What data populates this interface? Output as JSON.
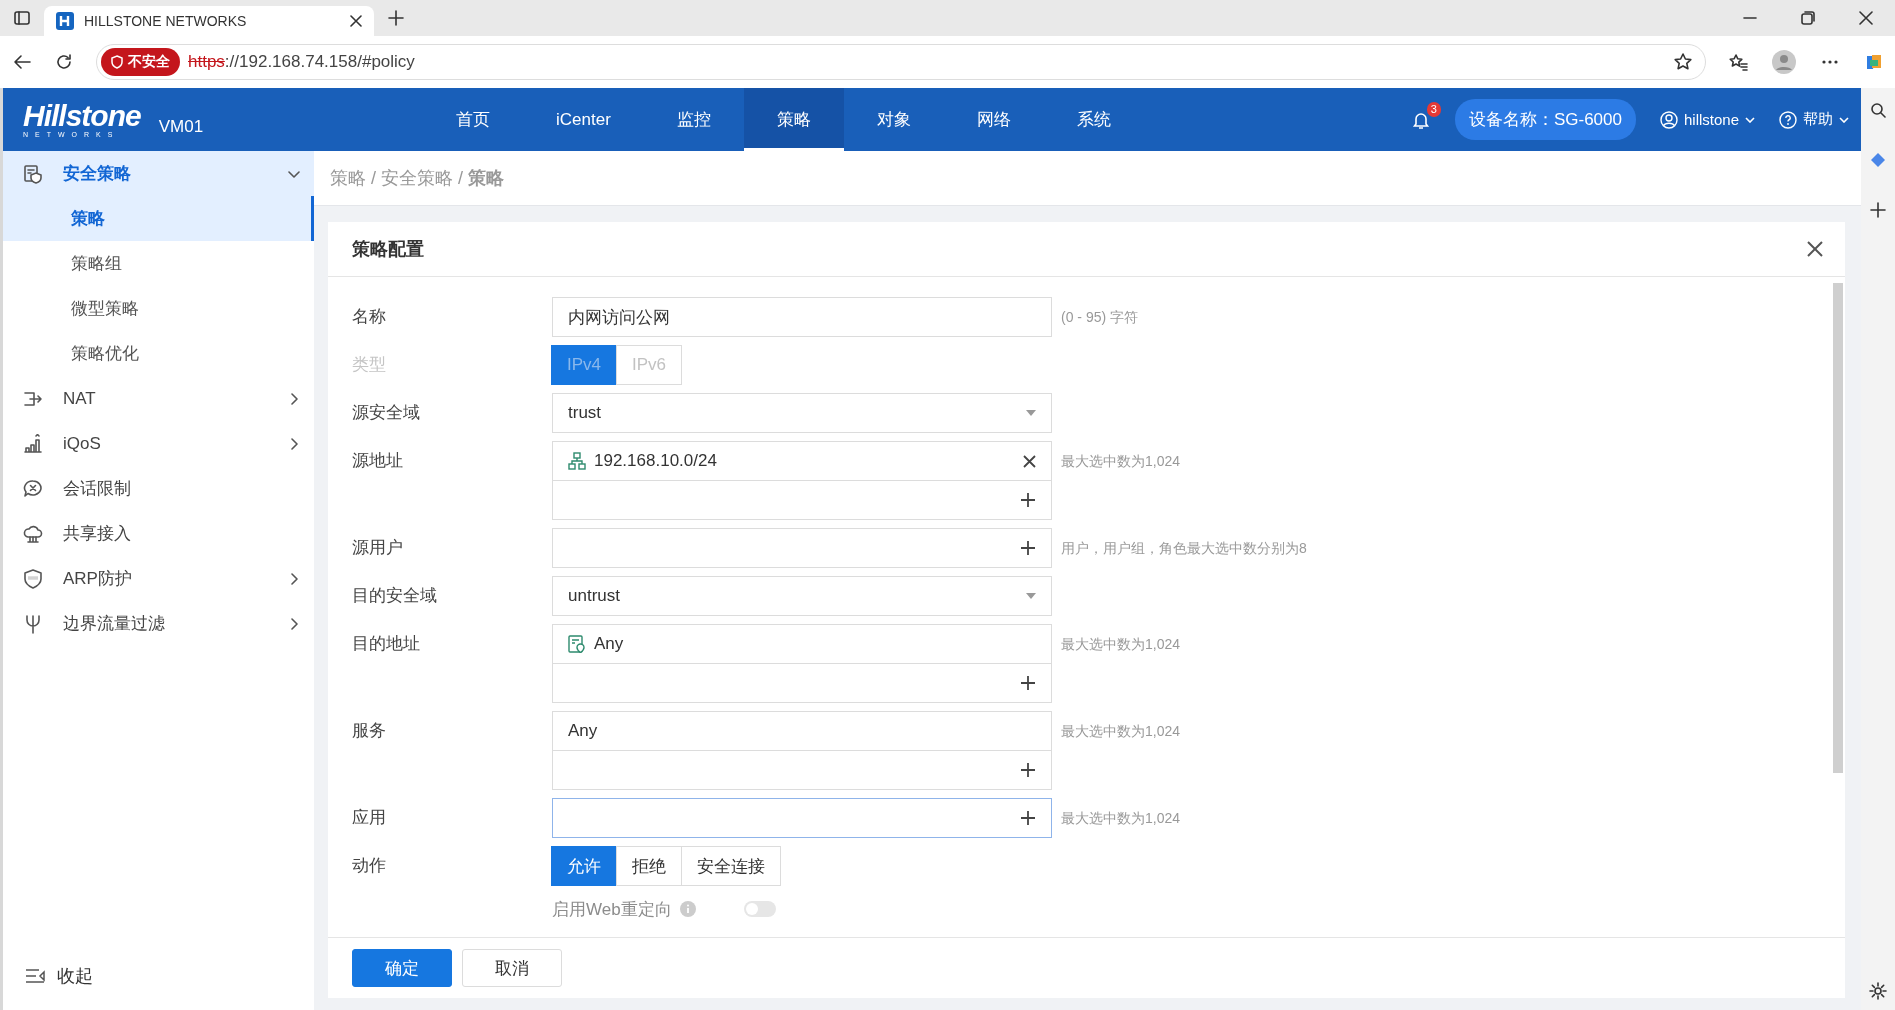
{
  "browser": {
    "tab_title": "HILLSTONE NETWORKS",
    "security_badge": "不安全",
    "url_scheme": "https",
    "url_rest": "://192.168.74.158/#policy"
  },
  "header": {
    "logo": "Hillstone",
    "logo_sub": "NETWORKS",
    "device": "VM01",
    "nav": [
      {
        "label": "首页",
        "selected": false
      },
      {
        "label": "iCenter",
        "selected": false
      },
      {
        "label": "监控",
        "selected": false
      },
      {
        "label": "策略",
        "selected": true
      },
      {
        "label": "对象",
        "selected": false
      },
      {
        "label": "网络",
        "selected": false
      },
      {
        "label": "系统",
        "selected": false
      }
    ],
    "notifications": "3",
    "device_name": "设备名称：SG-6000",
    "user": "hillstone",
    "help": "帮助"
  },
  "sidebar": {
    "items": [
      {
        "label": "安全策略",
        "kind": "menu",
        "expanded": true,
        "selected": true,
        "children": [
          {
            "label": "策略",
            "selected": true
          },
          {
            "label": "策略组",
            "selected": false
          },
          {
            "label": "微型策略",
            "selected": false
          },
          {
            "label": "策略优化",
            "selected": false
          }
        ]
      },
      {
        "label": "NAT",
        "kind": "menu",
        "expanded": false,
        "selected": false
      },
      {
        "label": "iQoS",
        "kind": "menu",
        "expanded": false,
        "selected": false
      },
      {
        "label": "会话限制",
        "kind": "link",
        "selected": false
      },
      {
        "label": "共享接入",
        "kind": "link",
        "selected": false
      },
      {
        "label": "ARP防护",
        "kind": "menu",
        "expanded": false,
        "selected": false
      },
      {
        "label": "边界流量过滤",
        "kind": "menu",
        "expanded": false,
        "selected": false
      }
    ],
    "collapse": "收起"
  },
  "breadcrumb": "策略 / 安全策略 / **策略**",
  "dialog": {
    "title": "策略配置",
    "fields": [
      {
        "kind": "text",
        "label": "名称",
        "value": "内网访问公网",
        "hint": "(0 - 95) 字符"
      },
      {
        "kind": "segmented",
        "label": "类型",
        "disabled": true,
        "options": [
          {
            "label": "IPv4",
            "selected": true
          },
          {
            "label": "IPv6",
            "selected": false
          }
        ]
      },
      {
        "kind": "select",
        "label": "源安全域",
        "value": "trust"
      },
      {
        "kind": "list",
        "label": "源地址",
        "items": [
          {
            "text": "192.168.10.0/24",
            "kind": "network",
            "removable": true
          }
        ],
        "hint": "最大选中数为1,024"
      },
      {
        "kind": "add",
        "label": "源用户",
        "focused": false,
        "hint": "用户，用户组，角色最大选中数分别为8"
      },
      {
        "kind": "select",
        "label": "目的安全域",
        "value": "untrust"
      },
      {
        "kind": "list",
        "label": "目的地址",
        "items": [
          {
            "text": "Any",
            "kind": "address",
            "removable": false
          }
        ],
        "hint": "最大选中数为1,024"
      },
      {
        "kind": "list",
        "label": "服务",
        "items": [
          {
            "text": "Any",
            "kind": "plain",
            "removable": false
          }
        ],
        "hint": "最大选中数为1,024"
      },
      {
        "kind": "add",
        "label": "应用",
        "focused": true,
        "hint": "最大选中数为1,024"
      },
      {
        "kind": "segmented",
        "label": "动作",
        "options": [
          {
            "label": "允许",
            "selected": true
          },
          {
            "label": "拒绝",
            "selected": false
          },
          {
            "label": "安全连接",
            "selected": false
          }
        ]
      },
      {
        "kind": "toggle",
        "label": "启用Web重定向",
        "on": false,
        "disabled": true
      }
    ],
    "buttons": [
      {
        "label": "确定",
        "kind": "primary"
      },
      {
        "label": "取消",
        "kind": "default"
      }
    ]
  }
}
